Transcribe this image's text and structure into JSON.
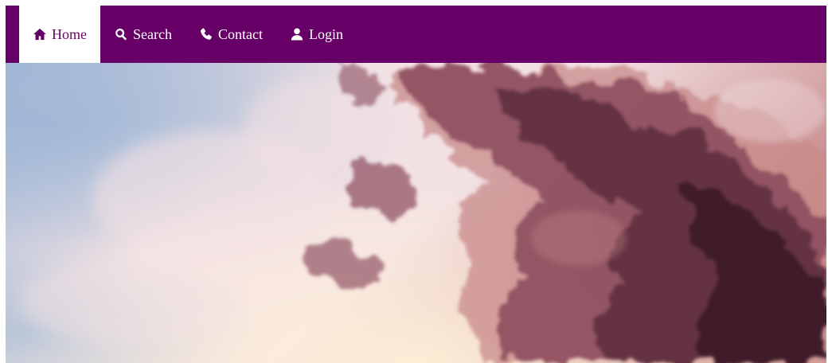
{
  "theme": {
    "nav_background": "#660066",
    "nav_text": "#ffffff",
    "active_background": "#ffffff",
    "active_text": "#660066"
  },
  "nav": {
    "items": [
      {
        "label": "Home",
        "icon": "home-icon",
        "active": true
      },
      {
        "label": "Search",
        "icon": "search-icon",
        "active": false
      },
      {
        "label": "Contact",
        "icon": "phone-icon",
        "active": false
      },
      {
        "label": "Login",
        "icon": "user-icon",
        "active": false
      }
    ]
  },
  "hero": {
    "image": "sunset-sky-with-pink-and-purple-clouds",
    "colors": {
      "sky_blue": "#9fb7d6",
      "sky_light": "#f3e2e4",
      "glow": "#fff0d8",
      "cloud_mauve": "#8a4a5c",
      "cloud_dark": "#5e2f3e",
      "cloud_deep": "#3c1b28",
      "cloud_rose": "#c88a8a"
    }
  }
}
